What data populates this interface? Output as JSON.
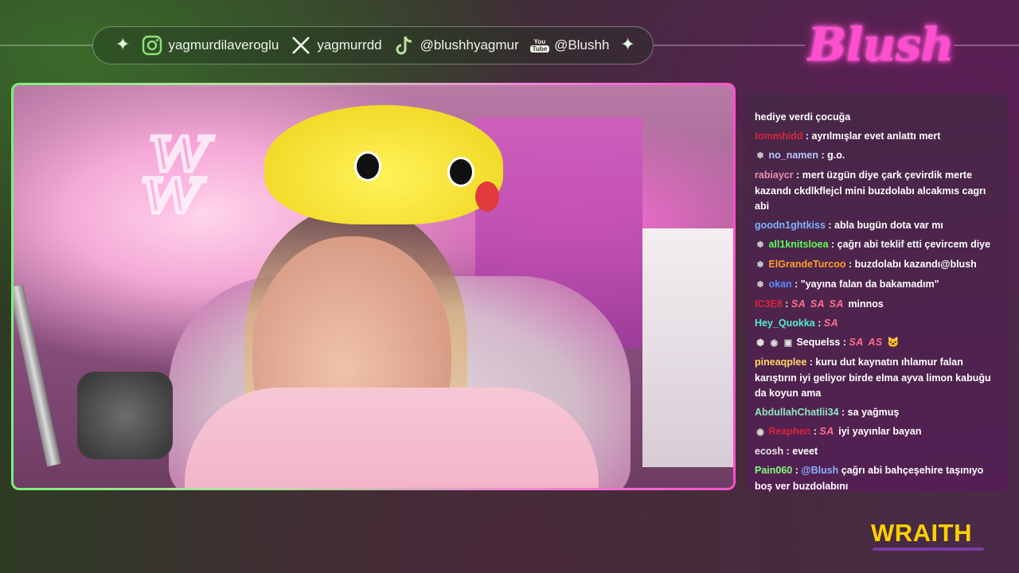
{
  "socials": [
    {
      "icon": "instagram-icon",
      "glyph": "◎",
      "handle": "yagmurdilaveroglu"
    },
    {
      "icon": "x-icon",
      "glyph": "𝕏",
      "handle": "yagmurrdd"
    },
    {
      "icon": "tiktok-icon",
      "glyph": "♪",
      "handle": "@blushhyagmur"
    },
    {
      "icon": "youtube-icon",
      "glyph_top": "You",
      "glyph_bottom": "Tube",
      "handle": "@Blushh"
    }
  ],
  "sparkle": "✦",
  "logo": "Blush",
  "sponsor": "WRAITH",
  "colors": {
    "accent_pink": "#ff4fcf",
    "accent_green": "#7cf07a",
    "sponsor_yellow": "#ffd000"
  },
  "chat": [
    {
      "user": "",
      "color": "#ffffff",
      "badges": [],
      "sa": [],
      "text": "hediye verdi çocuğa"
    },
    {
      "user": "tommhidd",
      "color": "#d7263d",
      "badges": [],
      "sa": [],
      "text": " : ayrılmışlar evet anlattı mert"
    },
    {
      "user": "no_namen",
      "color": "#b9c6ff",
      "badges": [
        "❄"
      ],
      "sa": [],
      "text": " : g.o."
    },
    {
      "user": "rabiaycr",
      "color": "#e88fb0",
      "badges": [],
      "sa": [],
      "text": " : mert üzgün diye çark çevirdik merte kazandı ckdlkflejcl mini buzdolabı alcakmıs cagrı abi"
    },
    {
      "user": "goodn1ghtkiss",
      "color": "#7fb3ff",
      "badges": [],
      "sa": [],
      "text": " : abla bugün dota var mı"
    },
    {
      "user": "all1knitsloea",
      "color": "#59ff59",
      "badges": [
        "❄"
      ],
      "sa": [],
      "text": " : çağrı abi teklif etti çevircem diye"
    },
    {
      "user": "ElGrandeTurcoo",
      "color": "#ff9d2e",
      "badges": [
        "❄"
      ],
      "sa": [],
      "text": " : buzdolabı kazandı@blush"
    },
    {
      "user": "okan",
      "color": "#5a8cff",
      "badges": [
        "❄"
      ],
      "sa": [],
      "text": " : \"yayına falan da bakamadım\""
    },
    {
      "user": "IC3E8",
      "color": "#d7263d",
      "badges": [],
      "sa": [
        "SA",
        "SA",
        "SA"
      ],
      "text": " minnos"
    },
    {
      "user": "Hey_Quokka",
      "color": "#4ff0c8",
      "badges": [],
      "sa": [
        "SA"
      ],
      "text": ""
    },
    {
      "user": "Sequelss",
      "color": "#ffffff",
      "badges": [
        "⬢",
        "◉",
        "▣"
      ],
      "sa": [
        "SA",
        "AS"
      ],
      "text": " 🐱"
    },
    {
      "user": "pineaqplee",
      "color": "#ffd966",
      "badges": [],
      "sa": [],
      "text": " : kuru dut kaynatın ıhlamur falan karıştırın iyi geliyor birde elma ayva limon kabuğu da koyun ama"
    },
    {
      "user": "AbdullahChatlii34",
      "color": "#8de8c0",
      "badges": [],
      "sa": [],
      "text": " : sa yağmuş"
    },
    {
      "user": "Reaphen",
      "color": "#d7263d",
      "badges": [
        "◉"
      ],
      "sa": [
        "SA"
      ],
      "text": " iyi yayınlar bayan"
    },
    {
      "user": "ecosh",
      "color": "#e8e8e8",
      "badges": [],
      "sa": [],
      "text": " : eveet"
    },
    {
      "user": "Pain060",
      "color": "#7cff7c",
      "badges": [],
      "sa": [],
      "mention": "@Blush",
      "text": " çağrı abi bahçeşehire taşınıyo boş ver buzdolabını"
    }
  ]
}
